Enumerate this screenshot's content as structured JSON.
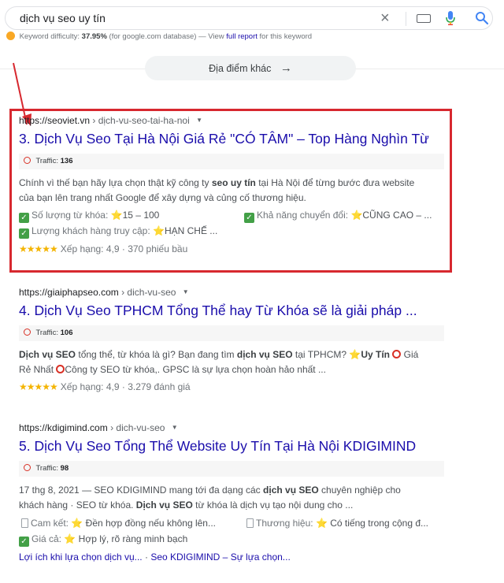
{
  "search": {
    "query": "dịch vụ seo uy tín"
  },
  "keyword": {
    "prefix": "Keyword difficulty:",
    "value": "37.95%",
    "middle": "(for google.com database) — View",
    "link": "full report",
    "suffix": "for this keyword"
  },
  "places_button": {
    "label": "Địa điểm khác",
    "arrow": "→"
  },
  "results": [
    {
      "url_domain": "https://seoviet.vn",
      "url_path": "› dịch-vu-seo-tai-ha-noi",
      "title": "3. Dịch Vụ Seo Tại Hà Nội Giá Rẻ \"CÓ TÂM\" – Top Hàng Nghìn Từ",
      "traffic_label": "Traffic:",
      "traffic_value": "136",
      "snippet_1a": "Chính vì thế bạn hãy lựa chọn thật kỹ công ty ",
      "snippet_1b": "seo uy tín",
      "snippet_1c": " tại Hà Nội để từng bước đưa website",
      "snippet_2": "của bạn lên trang nhất Google để xây dựng và củng cố thương hiệu.",
      "attr1_label": "Số lượng từ khóa:",
      "attr1_value": "15 – 100",
      "attr2_label": "Khả năng chuyển đổi:",
      "attr2_value": "CŨNG CAO – ...",
      "attr3_label": "Lượng khách hàng truy cập:",
      "attr3_value": "HẠN CHẾ ...",
      "rating_stars": "★★★★★",
      "rating_text": "Xếp hạng: 4,9 · 370 phiếu bầu"
    },
    {
      "url_domain": "https://giaiphapseo.com",
      "url_path": "› dich-vu-seo",
      "title": "4. Dịch Vụ Seo TPHCM Tổng Thể hay Từ Khóa sẽ là giải pháp ...",
      "traffic_label": "Traffic:",
      "traffic_value": "106",
      "snippet_1a": "Dịch vụ SEO",
      "snippet_1b": " tổng thể, từ khóa là gì? Bạn đang tìm ",
      "snippet_1c": "dịch vụ SEO",
      "snippet_1d": " tại TPHCM? ",
      "snippet_1e": "Uy Tín",
      "snippet_1f": " Giá",
      "snippet_2a": "Rẻ Nhất ",
      "snippet_2b": "Công ty SEO từ khóa,. GPSC là sự lựa chọn hoàn hảo nhất ...",
      "rating_stars": "★★★★★",
      "rating_text": "Xếp hạng: 4,9 · 3.279 đánh giá"
    },
    {
      "url_domain": "https://kdigimind.com",
      "url_path": "› dich-vu-seo",
      "title": "5. Dịch Vụ Seo Tổng Thể Website Uy Tín Tại Hà Nội KDIGIMIND",
      "traffic_label": "Traffic:",
      "traffic_value": "98",
      "snippet_1a": "17 thg 8, 2021 — SEO KDIGIMIND mang tới đa dạng các ",
      "snippet_1b": "dịch vụ SEO",
      "snippet_1c": " chuyên nghiệp cho",
      "snippet_2a": "khách hàng · SEO từ khóa. ",
      "snippet_2b": "Dịch vụ SEO",
      "snippet_2c": " từ khóa là dịch vụ tạo nội dung cho ...",
      "attr1_label": "Cam kết:",
      "attr1_value": "Đền hợp đồng nếu không lên...",
      "attr2_label": "Thương hiệu:",
      "attr2_value": "Có tiếng trong cộng đ...",
      "attr3_label": "Giá cả:",
      "attr3_value": "Hợp lý, rõ ràng minh bạch",
      "sitelink1": "Lợi ích khi lựa chọn dịch vụ...",
      "sitelink_sep": " · ",
      "sitelink2": "Seo KDIGIMIND – Sự lựa chọn..."
    }
  ],
  "icons": {
    "star": "⭐",
    "check": "✓",
    "dropdown": "▼",
    "clear": "×"
  },
  "colors": {
    "link": "#1a0dab",
    "highlight": "#d7282f",
    "check": "#43a047",
    "star": "#f4b400"
  }
}
